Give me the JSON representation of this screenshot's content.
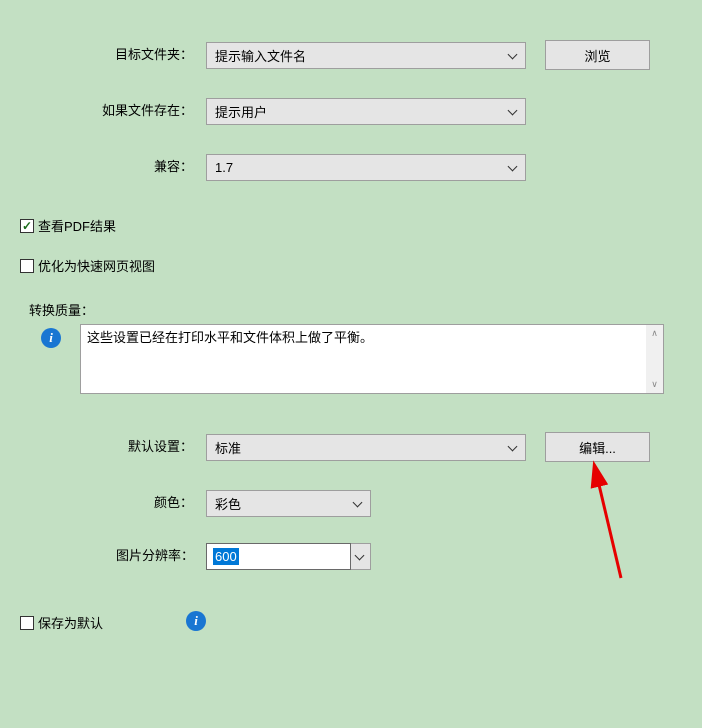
{
  "labels": {
    "targetFolder": "目标文件夹：",
    "ifFileExists": "如果文件存在：",
    "compatibility": "兼容：",
    "viewPdfResult": "查看PDF结果",
    "optimizeFastWeb": "优化为快速网页视图",
    "conversionQuality": "转换质量：",
    "defaultSettings": "默认设置：",
    "color": "颜色：",
    "imageResolution": "图片分辨率：",
    "saveAsDefault": "保存为默认"
  },
  "values": {
    "targetFolder": "提示输入文件名",
    "ifFileExists": "提示用户",
    "compatibility": "1.7",
    "qualityDescription": "这些设置已经在打印水平和文件体积上做了平衡。",
    "defaultSettings": "标准",
    "color": "彩色",
    "imageResolution": "600"
  },
  "buttons": {
    "browse": "浏览",
    "edit": "编辑..."
  },
  "checkboxes": {
    "viewPdfResult": true,
    "optimizeFastWeb": false,
    "saveAsDefault": false
  }
}
